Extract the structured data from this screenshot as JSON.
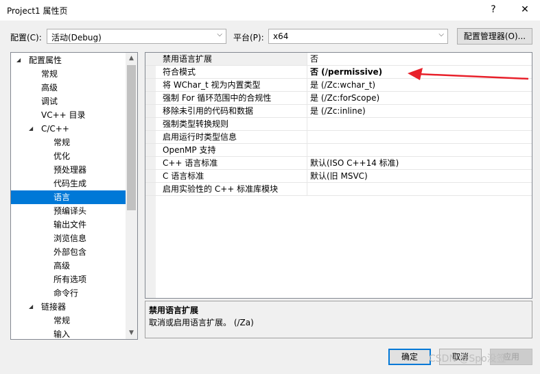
{
  "window": {
    "title": "Project1 属性页",
    "help_glyph": "?",
    "close_glyph": "✕"
  },
  "top": {
    "config_label": "配置(C):",
    "config_value": "活动(Debug)",
    "platform_label": "平台(P):",
    "platform_value": "x64",
    "config_manager_label": "配置管理器(O)..."
  },
  "tree": {
    "items": [
      {
        "label": "配置属性",
        "level": 0,
        "expanded": true
      },
      {
        "label": "常规",
        "level": 1
      },
      {
        "label": "高级",
        "level": 1
      },
      {
        "label": "调试",
        "level": 1
      },
      {
        "label": "VC++ 目录",
        "level": 1
      },
      {
        "label": "C/C++",
        "level": 1,
        "expanded": true
      },
      {
        "label": "常规",
        "level": 2
      },
      {
        "label": "优化",
        "level": 2
      },
      {
        "label": "预处理器",
        "level": 2
      },
      {
        "label": "代码生成",
        "level": 2
      },
      {
        "label": "语言",
        "level": 2,
        "selected": true
      },
      {
        "label": "预编译头",
        "level": 2
      },
      {
        "label": "输出文件",
        "level": 2
      },
      {
        "label": "浏览信息",
        "level": 2
      },
      {
        "label": "外部包含",
        "level": 2
      },
      {
        "label": "高级",
        "level": 2
      },
      {
        "label": "所有选项",
        "level": 2
      },
      {
        "label": "命令行",
        "level": 2
      },
      {
        "label": "链接器",
        "level": 1,
        "expanded": true
      },
      {
        "label": "常规",
        "level": 2
      },
      {
        "label": "输入",
        "level": 2
      }
    ]
  },
  "grid": {
    "rows": [
      {
        "name": "禁用语言扩展",
        "value": "否",
        "bold": false,
        "selected": true
      },
      {
        "name": "符合模式",
        "value": "否 (/permissive)",
        "bold": true
      },
      {
        "name": "将 WChar_t 视为内置类型",
        "value": "是 (/Zc:wchar_t)",
        "bold": false
      },
      {
        "name": "强制 For 循环范围中的合规性",
        "value": "是 (/Zc:forScope)",
        "bold": false
      },
      {
        "name": "移除未引用的代码和数据",
        "value": "是 (/Zc:inline)",
        "bold": false
      },
      {
        "name": "强制类型转换规则",
        "value": "",
        "bold": false
      },
      {
        "name": "启用运行时类型信息",
        "value": "",
        "bold": false
      },
      {
        "name": "OpenMP 支持",
        "value": "",
        "bold": false
      },
      {
        "name": "C++ 语言标准",
        "value": "默认(ISO C++14 标准)",
        "bold": false
      },
      {
        "name": "C 语言标准",
        "value": "默认(旧 MSVC)",
        "bold": false
      },
      {
        "name": "启用实验性的 C++ 标准库模块",
        "value": "",
        "bold": false
      }
    ]
  },
  "description": {
    "title": "禁用语言扩展",
    "text": "取消或启用语言扩展。    (/Za)"
  },
  "buttons": {
    "ok": "确定",
    "cancel": "取消",
    "apply": "应用"
  },
  "watermark": "CSDN @Spo没签",
  "colors": {
    "selection": "#0078d7",
    "annotation_arrow": "#e8202a"
  }
}
